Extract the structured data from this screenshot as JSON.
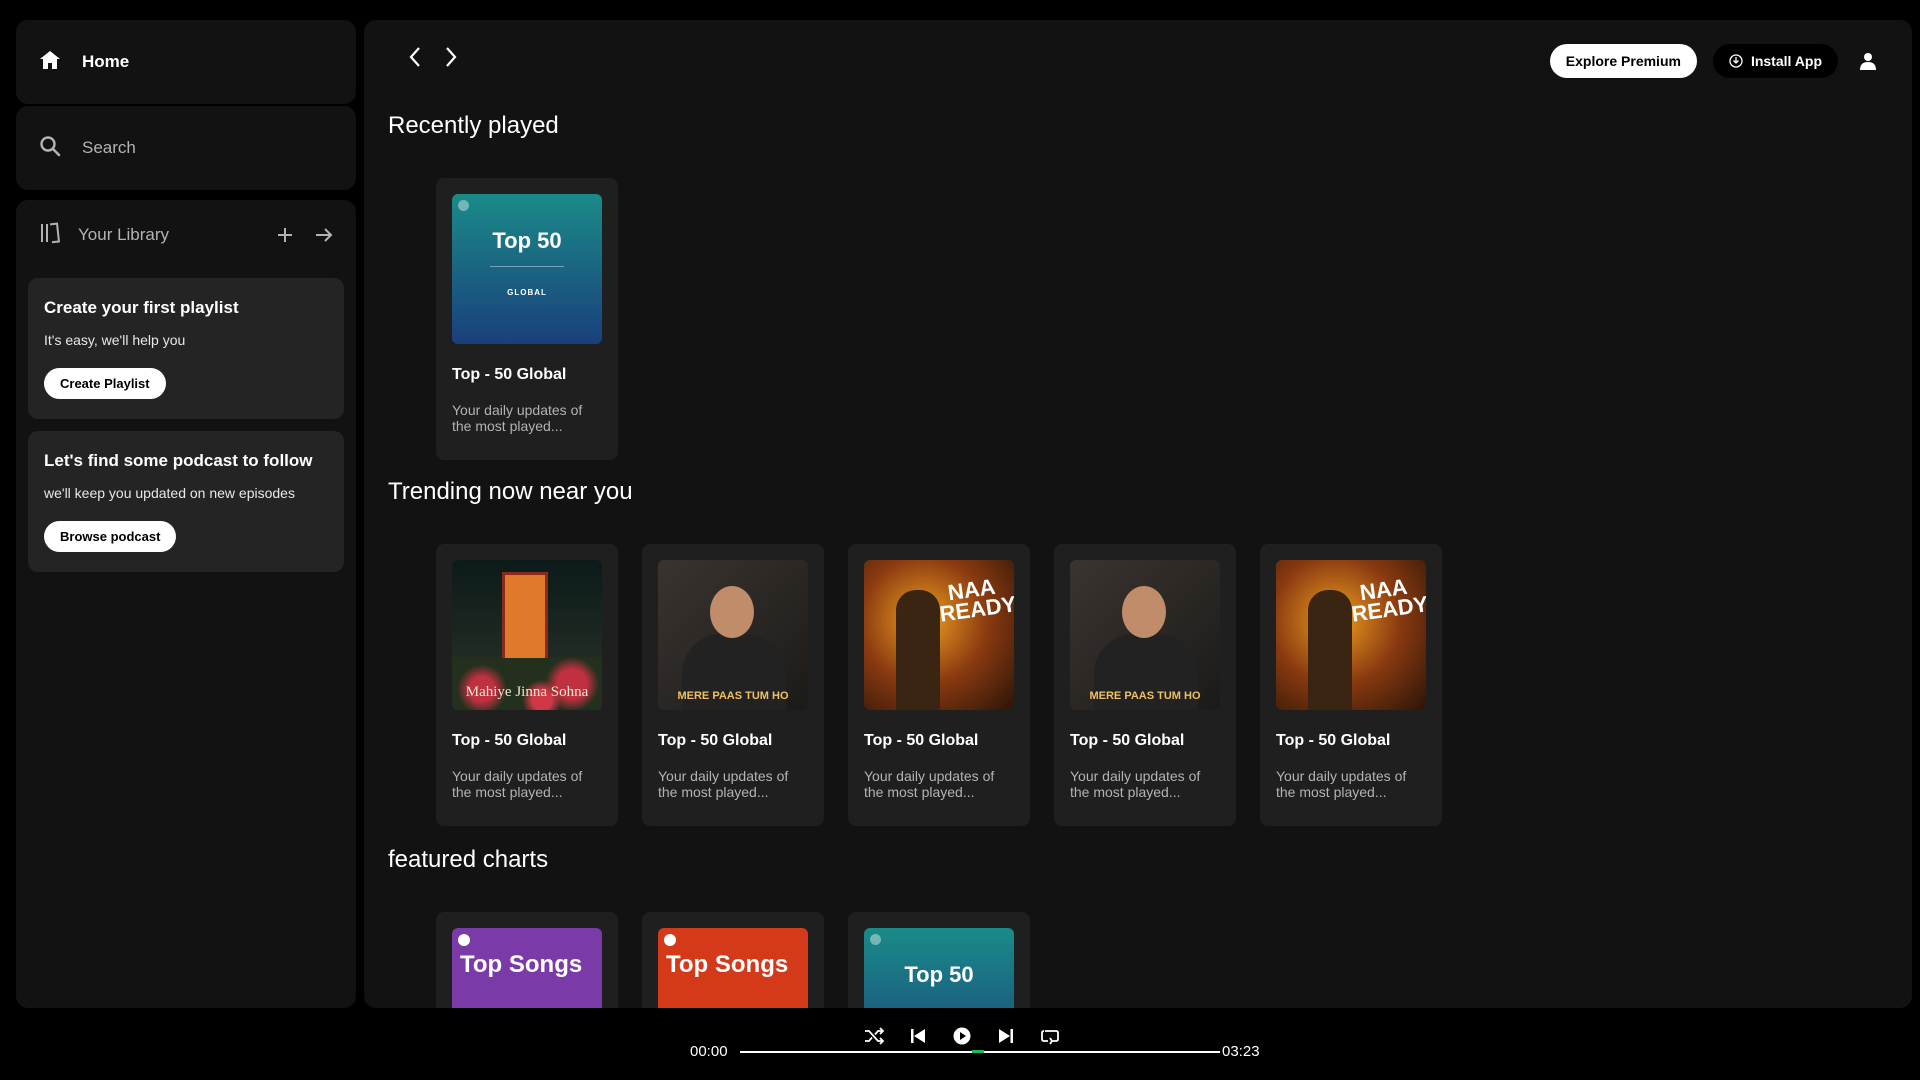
{
  "sidebar": {
    "home_label": "Home",
    "search_label": "Search",
    "library_label": "Your Library",
    "playlist_card": {
      "title": "Create your first playlist",
      "subtitle": "It's easy, we'll help you",
      "button": "Create Playlist"
    },
    "podcast_card": {
      "title": "Let's find some podcast to follow",
      "subtitle": "we'll keep you updated on new episodes",
      "button": "Browse podcast"
    }
  },
  "header": {
    "explore_button": "Explore Premium",
    "install_button": "Install App"
  },
  "sections": {
    "recent": {
      "title": "Recently played",
      "items": [
        {
          "title": "Top - 50 Global",
          "desc": "Your daily updates of the most played...",
          "art_title": "Top 50",
          "art_sub": "GLOBAL"
        }
      ]
    },
    "trending": {
      "title": "Trending now near you",
      "items": [
        {
          "title": "Top - 50 Global",
          "desc": "Your daily updates of the most played...",
          "art_text": "Mahiye Jinna Sohna"
        },
        {
          "title": "Top - 50 Global",
          "desc": "Your daily updates of the most played...",
          "art_text": "MERE PAAS TUM HO"
        },
        {
          "title": "Top - 50 Global",
          "desc": "Your daily updates of the most played...",
          "art_text": "NAA READY"
        },
        {
          "title": "Top - 50 Global",
          "desc": "Your daily updates of the most played...",
          "art_text": "MERE PAAS TUM HO"
        },
        {
          "title": "Top - 50 Global",
          "desc": "Your daily updates of the most played...",
          "art_text": "NAA READY"
        }
      ]
    },
    "featured": {
      "title": "featured charts",
      "items": [
        {
          "art_text": "Top Songs",
          "color": "#7a3aa8"
        },
        {
          "art_text": "Top Songs",
          "color": "#d43a1a"
        },
        {
          "art_text": "Top 50"
        }
      ]
    }
  },
  "player": {
    "elapsed": "00:00",
    "duration": "03:23",
    "progress": 0
  }
}
